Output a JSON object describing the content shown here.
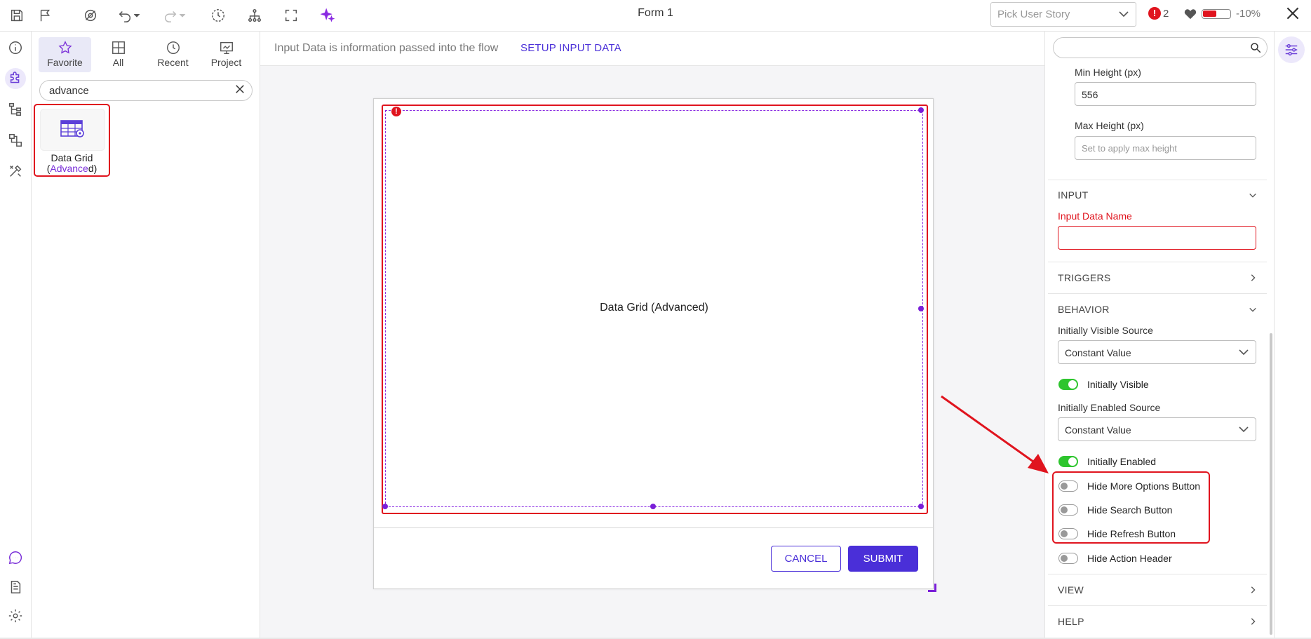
{
  "window": {
    "title": "Form 1"
  },
  "topbar": {
    "user_story_placeholder": "Pick User Story",
    "error_count": "2",
    "error_symbol": "!",
    "health_fraction": 0.5,
    "health_percent": "-10%"
  },
  "palette": {
    "tabs": [
      {
        "label": "Favorite",
        "icon": "star-icon"
      },
      {
        "label": "All",
        "icon": "grid-icon"
      },
      {
        "label": "Recent",
        "icon": "history-icon"
      },
      {
        "label": "Project",
        "icon": "project-icon"
      }
    ],
    "search_value": "advance",
    "item": {
      "label_pre": "Data Grid (",
      "label_match": "Advance",
      "label_post": "d)"
    }
  },
  "canvas": {
    "info_text": "Input Data is information passed into the flow",
    "setup_link": "SETUP INPUT DATA",
    "grid_label": "Data Grid (Advanced)",
    "error_symbol": "!",
    "cancel_label": "CANCEL",
    "submit_label": "SUBMIT"
  },
  "props": {
    "min_height_label": "Min Height (px)",
    "min_height_value": "556",
    "max_height_label": "Max Height (px)",
    "max_height_placeholder": "Set to apply max height",
    "input_section": "INPUT",
    "input_data_name_label": "Input Data Name",
    "input_data_name_value": "",
    "triggers_section": "TRIGGERS",
    "behavior_section": "BEHAVIOR",
    "visible_source_label": "Initially Visible Source",
    "visible_source_value": "Constant Value",
    "initially_visible_label": "Initially Visible",
    "enabled_source_label": "Initially Enabled Source",
    "enabled_source_value": "Constant Value",
    "initially_enabled_label": "Initially Enabled",
    "hide_more_options_label": "Hide More Options Button",
    "hide_search_label": "Hide Search Button",
    "hide_refresh_label": "Hide Refresh Button",
    "hide_action_header_label": "Hide Action Header",
    "view_section": "VIEW",
    "help_section": "HELP"
  },
  "colors": {
    "accent": "#4a2fd8",
    "error": "#e0141e",
    "toggle_on": "#2ec52e",
    "selection": "#7a1fd8"
  }
}
